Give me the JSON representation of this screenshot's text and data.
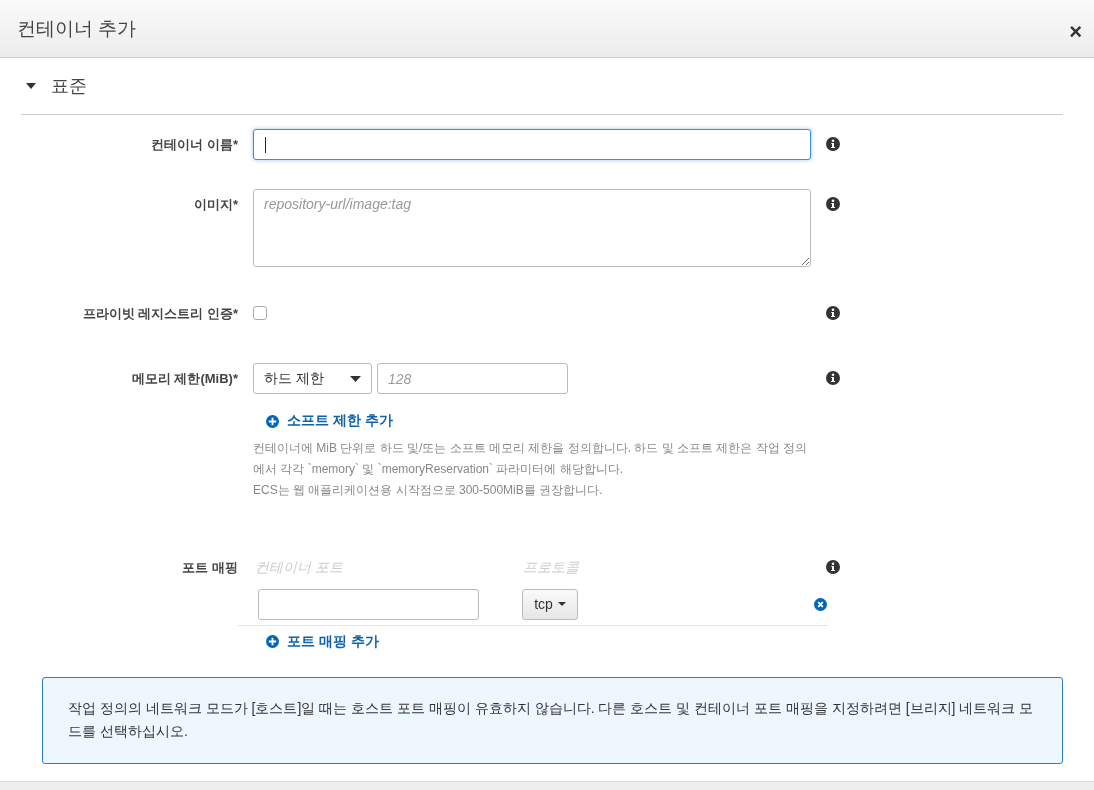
{
  "dialog": {
    "title": "컨테이너 추가",
    "close": "×"
  },
  "section": {
    "title": "표준",
    "expanded": true
  },
  "name_field": {
    "label": "컨테이너 이름*",
    "focused": true
  },
  "image_field": {
    "label": "이미지*",
    "placeholder": "repository-url/image:tag"
  },
  "private_registry": {
    "label": "프라이빗 레지스트리 인증*",
    "checked": false
  },
  "memory": {
    "label": "메모리 제한(MiB)*",
    "mode": "하드 제한",
    "placeholder": "128",
    "add_link": "소프트 제한 추가",
    "help": [
      "컨테이너에 MiB 단위로 하드 및/또는 소프트 메모리 제한을 정의합니다. 하드 및 소프트 제한은 작업 정의에서 각각 `memory` 및 `memoryReservation` 파라미터에 해당합니다.",
      "ECS는 웹 애플리케이션용 시작점으로 300-500MiB를 권장합니다."
    ]
  },
  "port_mappings": {
    "label": "포트 매핑",
    "columns": [
      "컨테이너 포트",
      "프로토콜"
    ],
    "rows": [
      {
        "protocol": "tcp"
      }
    ],
    "add_link": "포트 매핑 추가"
  },
  "alert": "작업 정의의 네트워크 모드가 [호스트]일 때는 호스트 포트 매핑이 유효하지 않습니다. 다른 호스트 및 컨테이너 포트 매핑을 지정하려면 [브리지] 네트워크 모드를 선택하십시오."
}
